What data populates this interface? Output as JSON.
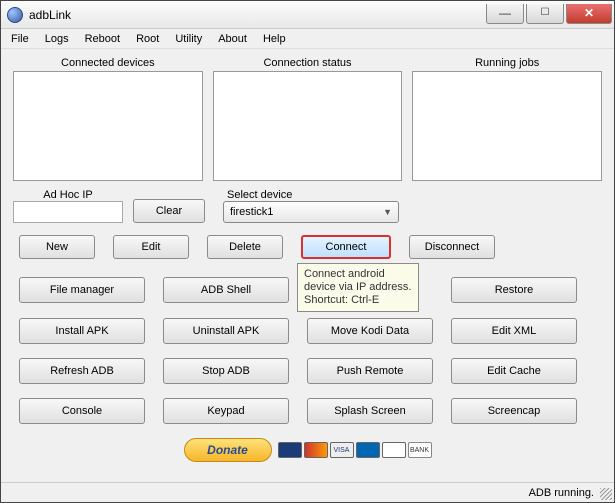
{
  "title": "adbLink",
  "menu": [
    "File",
    "Logs",
    "Reboot",
    "Root",
    "Utility",
    "About",
    "Help"
  ],
  "columns": {
    "connected": "Connected devices",
    "status": "Connection status",
    "jobs": "Running jobs"
  },
  "adhoc": {
    "label": "Ad Hoc IP",
    "value": "",
    "placeholder": ""
  },
  "clear": "Clear",
  "select": {
    "label": "Select device",
    "value": "firestick1"
  },
  "row3": {
    "new": "New",
    "edit": "Edit",
    "delete": "Delete",
    "connect": "Connect",
    "disconnect": "Disconnect"
  },
  "tooltip": "Connect android device via IP address. Shortcut: Ctrl-E",
  "grid": [
    "File manager",
    "ADB Shell",
    "",
    "Restore",
    "Install APK",
    "Uninstall APK",
    "Move Kodi Data",
    "Edit XML",
    "Refresh ADB",
    "Stop ADB",
    "Push Remote",
    "Edit Cache",
    "Console",
    "Keypad",
    "Splash Screen",
    "Screencap"
  ],
  "donate": "Donate",
  "status": "ADB running.",
  "winbtns": {
    "min": "—",
    "max": "☐",
    "close": "✕"
  }
}
